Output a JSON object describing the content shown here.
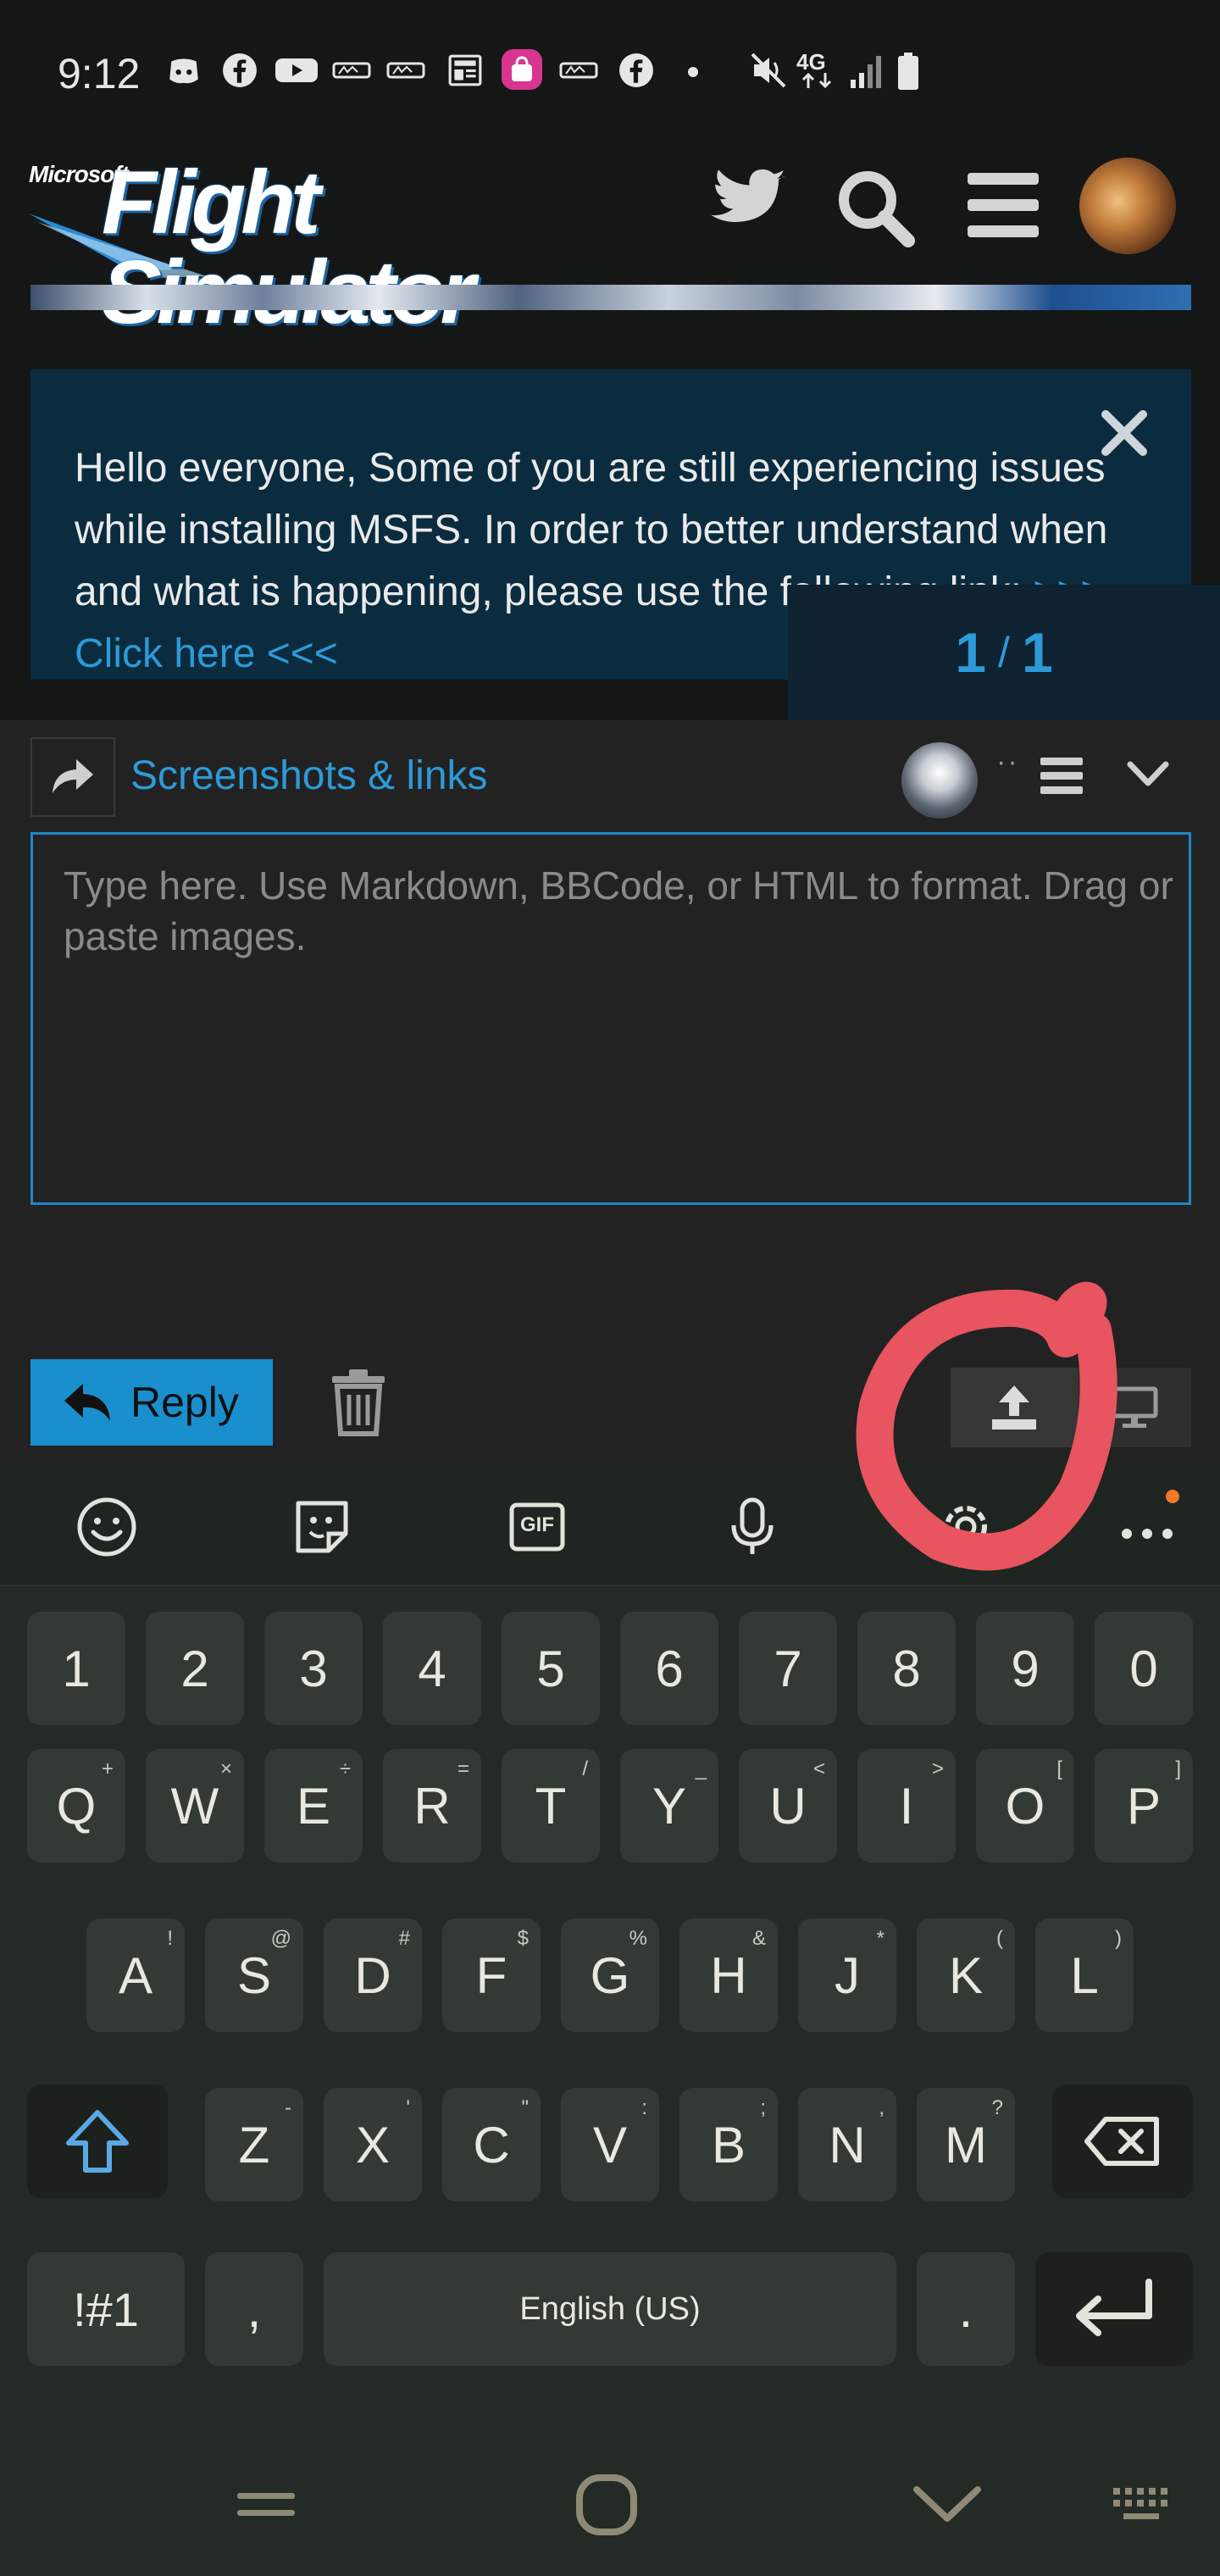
{
  "status_bar": {
    "time": "9:12",
    "notification_icons": [
      "discord-icon",
      "facebook-icon",
      "youtube-icon",
      "app-icon",
      "app-icon",
      "news-icon",
      "shopping-icon",
      "app-icon",
      "facebook-icon",
      "dot-icon"
    ],
    "system_icons": [
      "mute-icon",
      "4g-icon",
      "signal-icon",
      "battery-icon"
    ],
    "network_label": "4G"
  },
  "header": {
    "logo_small": "Microsoft",
    "logo_main": "Flight Simulator",
    "icons": [
      "twitter-icon",
      "search-icon",
      "menu-icon",
      "avatar"
    ]
  },
  "announcement": {
    "text": "Hello everyone, Some of you are still experiencing issues while installing MSFS. In order to better understand when and what is happening, please use the following link: ",
    "link": ">>> Click here <<<"
  },
  "counter": {
    "current": "1",
    "separator": "/",
    "total": "1"
  },
  "composer": {
    "title": "Screenshots & links",
    "dots": "··",
    "placeholder": "Type here. Use Markdown, BBCode, or HTML to format. Drag or paste images.",
    "reply_label": "Reply"
  },
  "keyboard": {
    "toolbar": [
      "emoji-icon",
      "sticker-icon",
      "gif-icon",
      "mic-icon",
      "settings-icon",
      "more-icon"
    ],
    "gif_label": "GIF",
    "row_numbers": [
      "1",
      "2",
      "3",
      "4",
      "5",
      "6",
      "7",
      "8",
      "9",
      "0"
    ],
    "row1": [
      {
        "key": "Q",
        "sub": "+"
      },
      {
        "key": "W",
        "sub": "×"
      },
      {
        "key": "E",
        "sub": "÷"
      },
      {
        "key": "R",
        "sub": "="
      },
      {
        "key": "T",
        "sub": "/"
      },
      {
        "key": "Y",
        "sub": "_"
      },
      {
        "key": "U",
        "sub": "<"
      },
      {
        "key": "I",
        "sub": ">"
      },
      {
        "key": "O",
        "sub": "["
      },
      {
        "key": "P",
        "sub": "]"
      }
    ],
    "row2": [
      {
        "key": "A",
        "sub": "!"
      },
      {
        "key": "S",
        "sub": "@"
      },
      {
        "key": "D",
        "sub": "#"
      },
      {
        "key": "F",
        "sub": "$"
      },
      {
        "key": "G",
        "sub": "%"
      },
      {
        "key": "H",
        "sub": "&"
      },
      {
        "key": "J",
        "sub": "*"
      },
      {
        "key": "K",
        "sub": "("
      },
      {
        "key": "L",
        "sub": ")"
      }
    ],
    "row3": [
      {
        "key": "Z",
        "sub": "-"
      },
      {
        "key": "X",
        "sub": "'"
      },
      {
        "key": "C",
        "sub": "\""
      },
      {
        "key": "V",
        "sub": ":"
      },
      {
        "key": "B",
        "sub": ";"
      },
      {
        "key": "N",
        "sub": ","
      },
      {
        "key": "M",
        "sub": "?"
      }
    ],
    "symbols_label": "!#1",
    "comma_label": ",",
    "space_label": "English (US)",
    "period_label": "."
  },
  "nav_bar": [
    "recents-icon",
    "home-icon",
    "back-icon",
    "keyboard-icon"
  ],
  "colors": {
    "accent": "#1a8fce",
    "annotation": "#e8545f",
    "announcement_bg": "#0b2c3f"
  }
}
